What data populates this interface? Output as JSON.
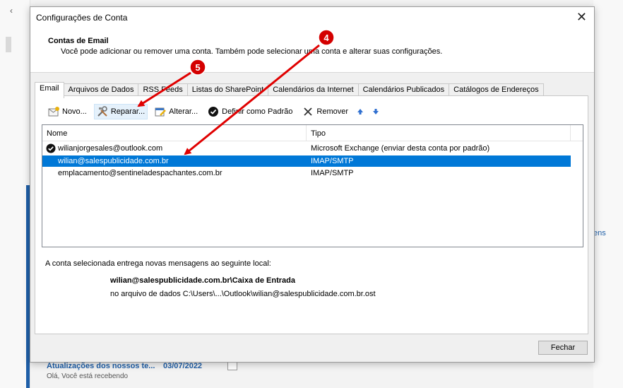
{
  "background": {
    "back_glyph": "‹",
    "right_link": "ens",
    "mail_title": "Atualizações dos nossos te...",
    "mail_date": "03/07/2022",
    "mail_preview": "Olá, Você está recebendo"
  },
  "dialog": {
    "title": "Configurações de Conta",
    "close_glyph": "✕",
    "header_title": "Contas de Email",
    "header_desc": "Você pode adicionar ou remover uma conta. Também pode selecionar uma conta e alterar suas configurações."
  },
  "tabs": [
    {
      "label": "Email",
      "active": true
    },
    {
      "label": "Arquivos de Dados"
    },
    {
      "label": "RSS Feeds"
    },
    {
      "label": "Listas do SharePoint"
    },
    {
      "label": "Calendários da Internet"
    },
    {
      "label": "Calendários Publicados"
    },
    {
      "label": "Catálogos de Endereços"
    }
  ],
  "toolbar": {
    "novo": "Novo...",
    "reparar": "Reparar...",
    "alterar": "Alterar...",
    "definir": "Definir como Padrão",
    "remover": "Remover"
  },
  "list": {
    "col_name": "Nome",
    "col_type": "Tipo",
    "rows": [
      {
        "name": "wilianjorgesales@outlook.com",
        "type": "Microsoft Exchange (enviar desta conta por padrão)",
        "default": true
      },
      {
        "name": "wilian@salespublicidade.com.br",
        "type": "IMAP/SMTP",
        "selected": true
      },
      {
        "name": "emplacamento@sentineladespachantes.com.br",
        "type": "IMAP/SMTP"
      }
    ]
  },
  "delivery": {
    "intro": "A conta selecionada entrega novas mensagens ao seguinte local:",
    "location": "wilian@salespublicidade.com.br\\Caixa de Entrada",
    "file": "no arquivo de dados C:\\Users\\...\\Outlook\\wilian@salespublicidade.com.br.ost"
  },
  "buttons": {
    "fechar": "Fechar"
  },
  "annotations": {
    "badge_4": "4",
    "badge_5": "5",
    "color": "#e00000"
  },
  "colors": {
    "selection": "#0078d7",
    "accent": "#1f5fa8"
  }
}
